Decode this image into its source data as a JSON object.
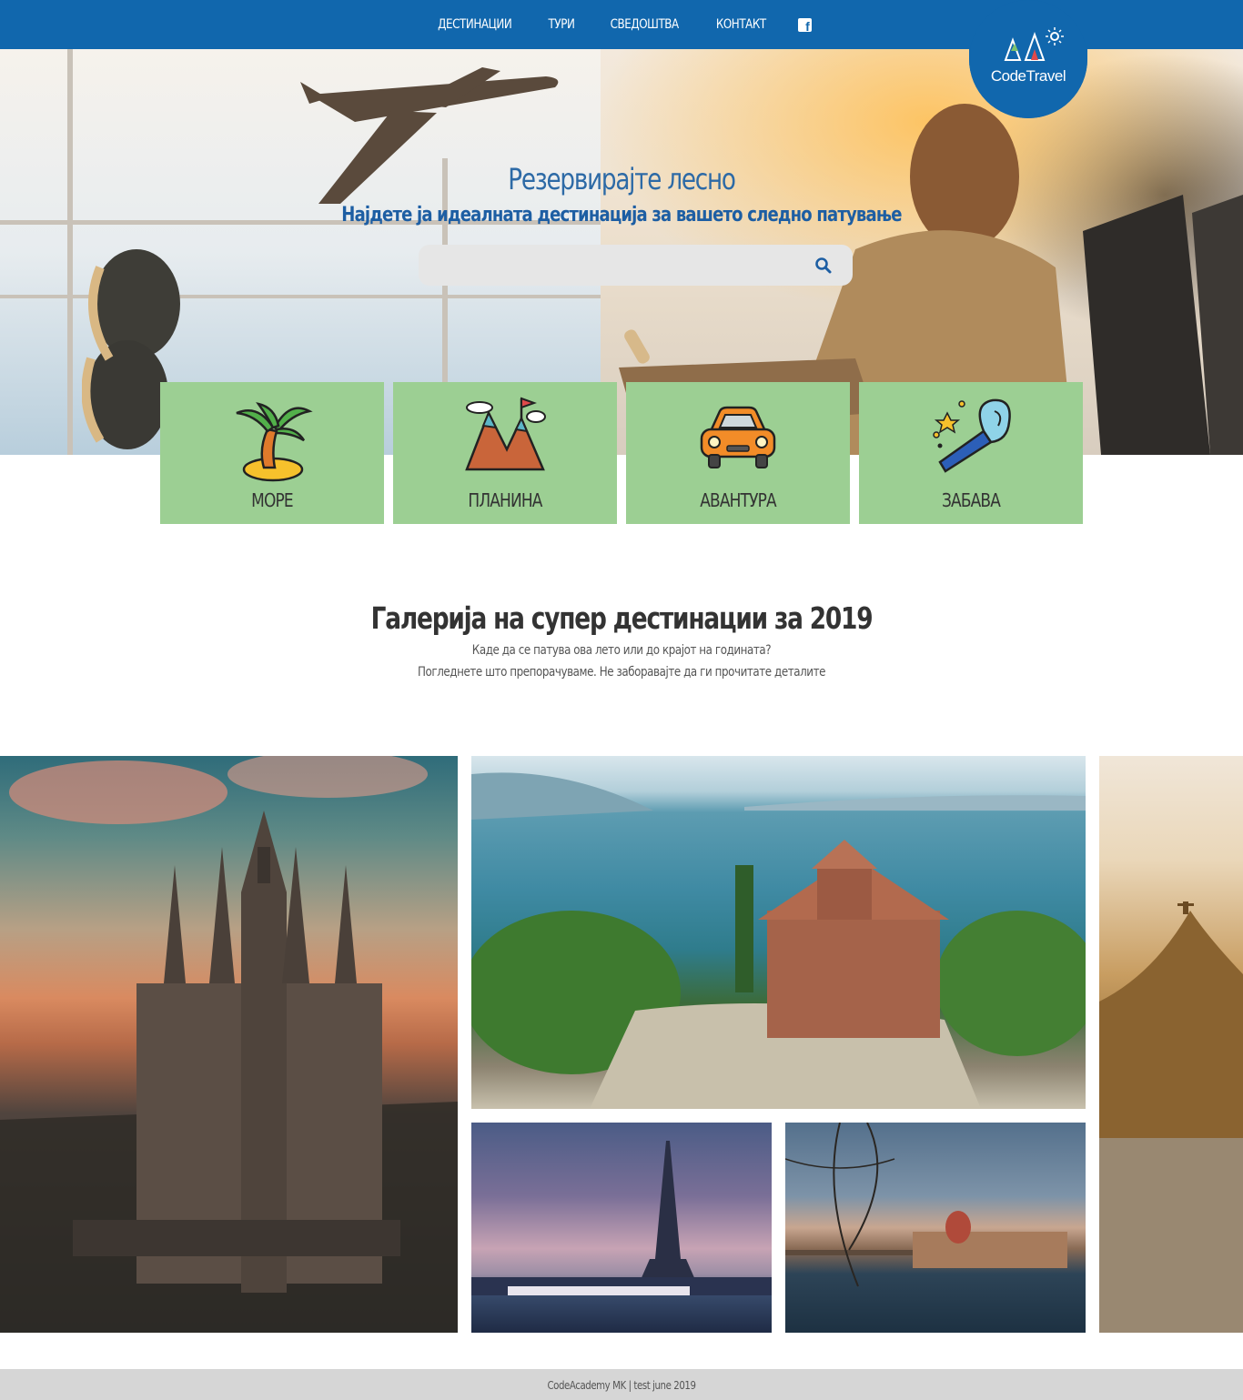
{
  "nav": {
    "items": [
      {
        "label": "ДЕСТИНАЦИИ"
      },
      {
        "label": "ТУРИ"
      },
      {
        "label": "СВЕДОШТВА"
      },
      {
        "label": "КОНТАКТ"
      }
    ],
    "social_icon": "facebook-icon"
  },
  "logo": {
    "text": "CodeTravel"
  },
  "hero": {
    "title": "Резервирајте лесно",
    "subtitle": "Најдете ја идеалната дестинација за вашето следно патување",
    "search": {
      "value": "",
      "placeholder": "",
      "icon": "search-icon"
    }
  },
  "categories": [
    {
      "label": "МОРЕ",
      "icon": "palm-island-icon"
    },
    {
      "label": "ПЛАНИНА",
      "icon": "mountain-flag-icon"
    },
    {
      "label": "АВАНТУРА",
      "icon": "car-icon"
    },
    {
      "label": "ЗАБАВА",
      "icon": "party-horn-icon"
    }
  ],
  "gallery": {
    "title": "Галерија на супер дестинации за 2019",
    "line1": "Каде да се патува ова лето или до крајот на годината?",
    "line2": "Погледнете што препорачуваме. Не заборавајте да ги прочитате деталите",
    "photos": [
      "barcelona-cathedral-photo",
      "ohrid-church-photo",
      "paris-eiffel-photo",
      "budapest-parliament-photo",
      "rio-christ-photo"
    ]
  },
  "colors": {
    "nav": "#1167ad",
    "tile": "#9ccf93",
    "footer": "#d6d6d6"
  },
  "footer": {
    "text": "CodeAcademy MK | test june 2019"
  }
}
